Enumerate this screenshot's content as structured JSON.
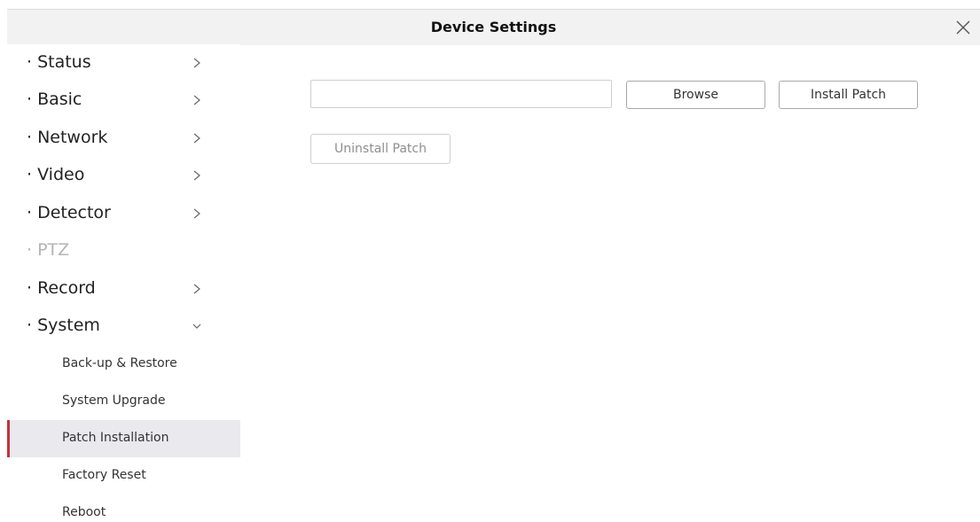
{
  "window": {
    "title": "Device Settings"
  },
  "sidebar": {
    "menu": [
      {
        "label": "· Status",
        "chevron": "right",
        "enabled": true
      },
      {
        "label": "· Basic",
        "chevron": "right",
        "enabled": true
      },
      {
        "label": "· Network",
        "chevron": "right",
        "enabled": true
      },
      {
        "label": "· Video",
        "chevron": "right",
        "enabled": true
      },
      {
        "label": "· Detector",
        "chevron": "right",
        "enabled": true
      },
      {
        "label": "· PTZ",
        "chevron": "none",
        "enabled": false
      },
      {
        "label": "· Record",
        "chevron": "right",
        "enabled": true
      },
      {
        "label": "· System",
        "chevron": "down",
        "enabled": true
      }
    ],
    "system_submenu": [
      {
        "label": "Back-up & Restore",
        "active": false
      },
      {
        "label": "System Upgrade",
        "active": false
      },
      {
        "label": "Patch Installation",
        "active": true
      },
      {
        "label": "Factory Reset",
        "active": false
      },
      {
        "label": "Reboot",
        "active": false
      }
    ]
  },
  "patch": {
    "file_path_value": "",
    "browse_label": "Browse",
    "install_label": "Install Patch",
    "uninstall_label": "Uninstall Patch"
  },
  "colors": {
    "active_indicator": "#c8303a",
    "active_row_bg": "#e9e9ee",
    "titlebar_bg": "#f2f2f2",
    "disabled_text": "#b4b4b4"
  },
  "icons": {
    "close": "close-icon",
    "collapsed": "chevron-right-icon",
    "expanded": "chevron-down-icon"
  }
}
